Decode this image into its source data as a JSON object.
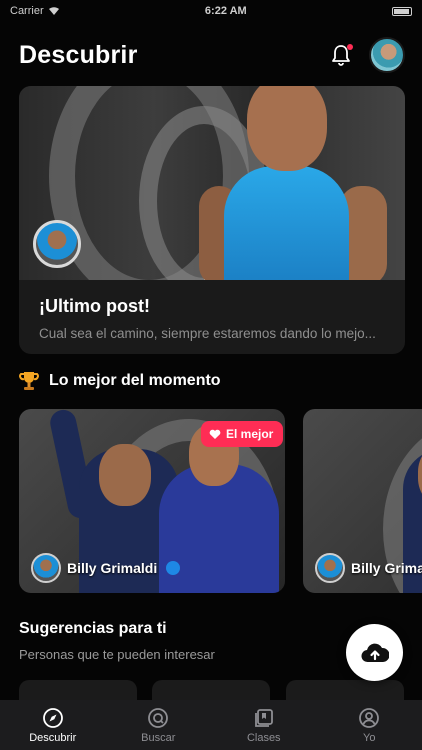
{
  "status_bar": {
    "carrier": "Carrier",
    "time": "6:22 AM"
  },
  "header": {
    "title": "Descubrir"
  },
  "hero": {
    "title": "¡Ultimo post!",
    "subtitle": "Cual sea el camino, siempre estaremos dando lo mejo..."
  },
  "best": {
    "title": "Lo mejor del momento",
    "cards": [
      {
        "badge": "El mejor",
        "user": "Billy Grimaldi"
      },
      {
        "user": "Billy Grima"
      }
    ]
  },
  "suggestions": {
    "title": "Sugerencias para ti",
    "subtitle": "Personas que te pueden interesar"
  },
  "tabs": [
    {
      "label": "Descubrir",
      "icon": "compass-icon",
      "active": true
    },
    {
      "label": "Buscar",
      "icon": "search-icon"
    },
    {
      "label": "Clases",
      "icon": "library-icon"
    },
    {
      "label": "Yo",
      "icon": "profile-icon"
    }
  ],
  "colors": {
    "accent": "#ff2d55",
    "background": "#050505",
    "tabbar": "#1c1c1e",
    "verified": "#1e88e5"
  }
}
